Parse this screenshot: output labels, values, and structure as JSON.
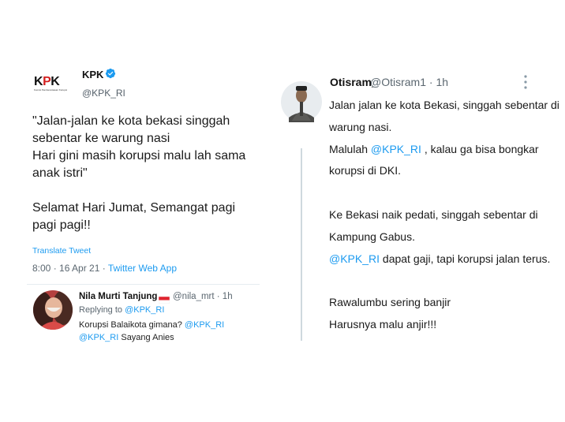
{
  "kpk_tweet": {
    "logo_text": "KPK",
    "logo_subtitle": "Komisi Pemberantasan Korupsi",
    "display_name": "KPK",
    "handle": "@KPK_RI",
    "text_lines": [
      "\"Jalan-jalan ke kota bekasi singgah",
      "sebentar ke warung nasi",
      "Hari gini masih korupsi malu lah sama",
      "anak istri\"",
      "",
      "Selamat Hari Jumat, Semangat pagi",
      "pagi pagi!!"
    ],
    "translate_label": "Translate Tweet",
    "time": "8:00 · 16 Apr 21 · ",
    "source": "Twitter Web App"
  },
  "reply": {
    "display_name": "Nila Murti Tanjung",
    "handle": "@nila_mrt · 1h",
    "replying_to_prefix": "Replying to ",
    "replying_to_handle": "@KPK_RI",
    "body_line1_text": "Korupsi Balaikota gimana? ",
    "body_line1_mention": "@KPK_RI",
    "body_line2_mention": "@KPK_RI",
    "body_line2_text": " Sayang Anies",
    "flag_colors": [
      "#e0242f",
      "#ffffff"
    ]
  },
  "otisram_tweet": {
    "display_name": "Otisram_",
    "handle": "@Otisram1 · 1h",
    "line1": "Jalan jalan ke kota Bekasi, singgah sebentar di",
    "line2": "warung nasi.",
    "line3_prefix": "Malulah ",
    "line3_mention": "@KPK_RI",
    "line3_suffix": " , kalau ga bisa bongkar",
    "line4": "korupsi di DKI.",
    "line5": "Ke Bekasi naik pedati, singgah sebentar di",
    "line6": "Kampung Gabus.",
    "line7_mention": "@KPK_RI",
    "line7_suffix": " dapat gaji, tapi korupsi jalan terus.",
    "line8": "Rawalumbu sering banjir",
    "line9": "Harusnya malu anjir!!!"
  },
  "colors": {
    "accent_link": "#1d9bf0",
    "kpk_red": "#d32020",
    "muted_text": "#5b6770",
    "thread_line": "#cfd9de"
  },
  "icons": {
    "verified": "verified-badge-icon",
    "more": "more-vertical-icon",
    "flag": "indonesia-flag-icon"
  }
}
